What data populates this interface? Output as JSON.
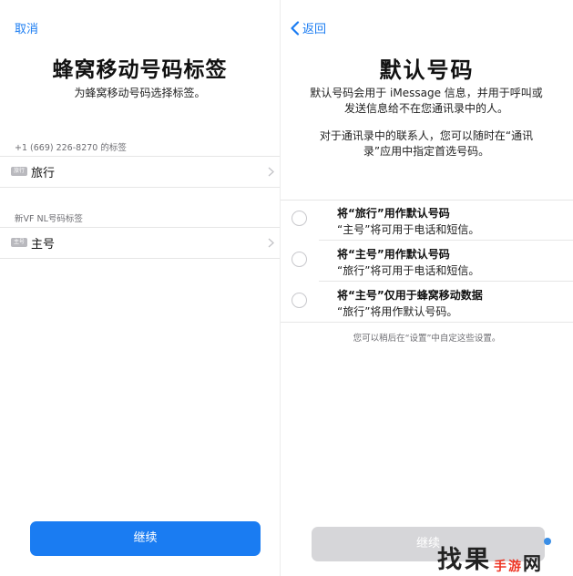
{
  "left_screen": {
    "cancel_label": "取消",
    "title": "蜂窝移动号码标签",
    "subtitle": "为蜂窝移动号码选择标签。",
    "sections": [
      {
        "header": "+1 (669) 226-8270 的标签",
        "badge": "旅行",
        "label": "旅行"
      },
      {
        "header": "新VF NL号码标签",
        "badge": "主号",
        "label": "主号"
      }
    ],
    "continue_label": "继续"
  },
  "right_screen": {
    "back_label": "返回",
    "title": "默认号码",
    "description_line1": "默认号码会用于 iMessage 信息，并用于呼叫或",
    "description_line2": "发送信息给不在您通讯录中的人。",
    "description_line3": "对于通讯录中的联系人，您可以随时在“通讯",
    "description_line4": "录”应用中指定首选号码。",
    "options": [
      {
        "title": "将“旅行”用作默认号码",
        "subtitle": "“主号”将可用于电话和短信。",
        "selected": false
      },
      {
        "title": "将“主号”用作默认号码",
        "subtitle": "“旅行”将可用于电话和短信。",
        "selected": false
      },
      {
        "title": "将“主号”仅用于蜂窝移动数据",
        "subtitle": "“旅行”将用作默认号码。",
        "selected": false
      }
    ],
    "footnote": "您可以稍后在“设置”中自定这些设置。",
    "continue_label": "继续"
  },
  "watermark": {
    "main": "找果",
    "small": "手游",
    "tail": "网"
  },
  "colors": {
    "accent": "#1a7cf2",
    "disabled_button": "#d6d6d9",
    "separator": "#e6e6e6",
    "secondary_text": "#6d6d72"
  }
}
